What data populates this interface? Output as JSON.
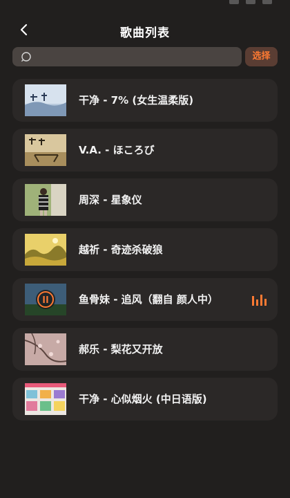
{
  "header": {
    "title": "歌曲列表"
  },
  "search": {
    "placeholder": "",
    "value": ""
  },
  "toolbar": {
    "select_label": "选择"
  },
  "colors": {
    "background": "#211f1e",
    "card": "#2b2827",
    "search": "#4a4441",
    "accent": "#ff7a33"
  },
  "songs": [
    {
      "label": "干净 - 7% (女生温柔版)"
    },
    {
      "label": "V.A. - ほころび"
    },
    {
      "label": "周深 - 星象仪"
    },
    {
      "label": "越祈 - 奇迹杀破狼"
    },
    {
      "label": "鱼骨妹 - 追风（翻自 颜人中）",
      "playing": true
    },
    {
      "label": "郝乐 - 梨花又开放"
    },
    {
      "label": "干净 - 心似烟火 (中日语版)"
    }
  ]
}
